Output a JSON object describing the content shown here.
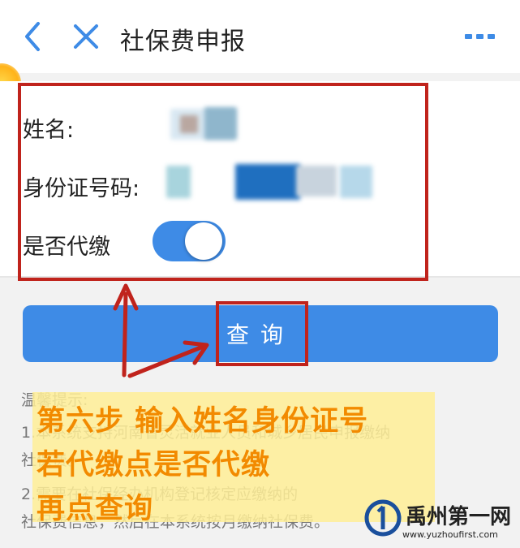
{
  "header": {
    "title": "社保费申报",
    "back_icon": "chevron-left-icon",
    "close_icon": "close-icon",
    "more_icon": "more-icon"
  },
  "form": {
    "name_label": "姓名:",
    "id_label": "身份证号码:",
    "agent_label": "是否代缴",
    "agent_enabled": true
  },
  "query_button": {
    "label": "查询"
  },
  "tips": {
    "title": "温馨提示:",
    "line1": "1.本系统支持河南省灵活就业人员和城乡居民申报缴纳",
    "line1b": "社保费。",
    "line2": "2.需要在社保经办机构登记核定应缴纳的",
    "line3": "社保费信息，然后在本系统按月缴纳社保费。"
  },
  "annotation": {
    "line1": "第六步 输入姓名身份证号",
    "line2": "若代缴点是否代缴",
    "line3": "再点查询"
  },
  "watermark": {
    "name": "禹州第一网",
    "url": "www.yuzhoufirst.com"
  },
  "colors": {
    "accent": "#3e8be6",
    "annotation_red": "#c0231c",
    "annotation_orange": "#f28a00"
  }
}
